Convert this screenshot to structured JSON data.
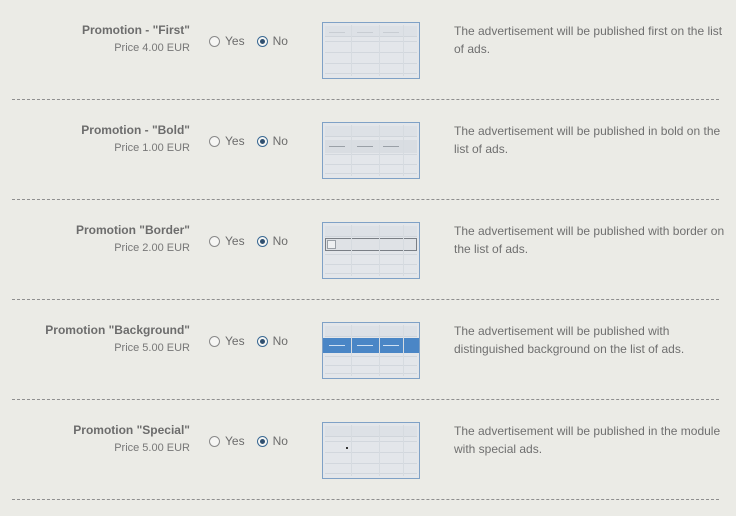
{
  "promotions": [
    {
      "title": "Promotion - \"First\"",
      "price": "Price 4.00  EUR",
      "yes_label": "Yes",
      "no_label": "No",
      "selected": "No",
      "preview": "first",
      "description": "The advertisement will be published first on the list of ads."
    },
    {
      "title": "Promotion - \"Bold\"",
      "price": "Price 1.00  EUR",
      "yes_label": "Yes",
      "no_label": "No",
      "selected": "No",
      "preview": "bold",
      "description": "The advertisement will be published in bold on the list of ads."
    },
    {
      "title": "Promotion \"Border\"",
      "price": "Price 2.00  EUR",
      "yes_label": "Yes",
      "no_label": "No",
      "selected": "No",
      "preview": "border",
      "description": "The advertisement will be published with border on the list of ads."
    },
    {
      "title": "Promotion \"Background\"",
      "price": "Price 5.00  EUR",
      "yes_label": "Yes",
      "no_label": "No",
      "selected": "No",
      "preview": "background",
      "description": "The advertisement will be published with distinguished background on the list of ads."
    },
    {
      "title": "Promotion \"Special\"",
      "price": "Price 5.00  EUR",
      "yes_label": "Yes",
      "no_label": "No",
      "selected": "No",
      "preview": "special",
      "description": "The advertisement will be published in the module with special ads."
    }
  ],
  "colors": {
    "page_background": "#ebebe6",
    "preview_border": "#7fa1c6",
    "highlight_background": "#4a86c6",
    "radio_selected": "#2f4f6f"
  }
}
